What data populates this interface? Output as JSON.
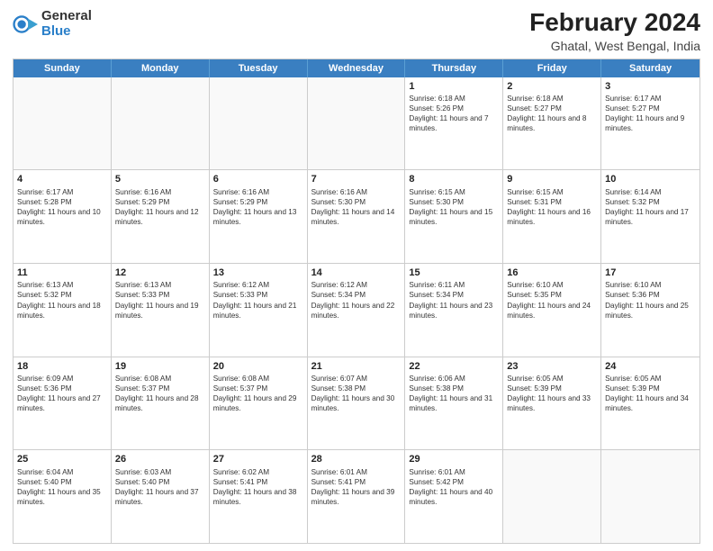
{
  "logo": {
    "general": "General",
    "blue": "Blue"
  },
  "title": "February 2024",
  "subtitle": "Ghatal, West Bengal, India",
  "headers": [
    "Sunday",
    "Monday",
    "Tuesday",
    "Wednesday",
    "Thursday",
    "Friday",
    "Saturday"
  ],
  "weeks": [
    [
      {
        "day": "",
        "info": "",
        "empty": true
      },
      {
        "day": "",
        "info": "",
        "empty": true
      },
      {
        "day": "",
        "info": "",
        "empty": true
      },
      {
        "day": "",
        "info": "",
        "empty": true
      },
      {
        "day": "1",
        "info": "Sunrise: 6:18 AM\nSunset: 5:26 PM\nDaylight: 11 hours and 7 minutes."
      },
      {
        "day": "2",
        "info": "Sunrise: 6:18 AM\nSunset: 5:27 PM\nDaylight: 11 hours and 8 minutes."
      },
      {
        "day": "3",
        "info": "Sunrise: 6:17 AM\nSunset: 5:27 PM\nDaylight: 11 hours and 9 minutes."
      }
    ],
    [
      {
        "day": "4",
        "info": "Sunrise: 6:17 AM\nSunset: 5:28 PM\nDaylight: 11 hours and 10 minutes."
      },
      {
        "day": "5",
        "info": "Sunrise: 6:16 AM\nSunset: 5:29 PM\nDaylight: 11 hours and 12 minutes."
      },
      {
        "day": "6",
        "info": "Sunrise: 6:16 AM\nSunset: 5:29 PM\nDaylight: 11 hours and 13 minutes."
      },
      {
        "day": "7",
        "info": "Sunrise: 6:16 AM\nSunset: 5:30 PM\nDaylight: 11 hours and 14 minutes."
      },
      {
        "day": "8",
        "info": "Sunrise: 6:15 AM\nSunset: 5:30 PM\nDaylight: 11 hours and 15 minutes."
      },
      {
        "day": "9",
        "info": "Sunrise: 6:15 AM\nSunset: 5:31 PM\nDaylight: 11 hours and 16 minutes."
      },
      {
        "day": "10",
        "info": "Sunrise: 6:14 AM\nSunset: 5:32 PM\nDaylight: 11 hours and 17 minutes."
      }
    ],
    [
      {
        "day": "11",
        "info": "Sunrise: 6:13 AM\nSunset: 5:32 PM\nDaylight: 11 hours and 18 minutes."
      },
      {
        "day": "12",
        "info": "Sunrise: 6:13 AM\nSunset: 5:33 PM\nDaylight: 11 hours and 19 minutes."
      },
      {
        "day": "13",
        "info": "Sunrise: 6:12 AM\nSunset: 5:33 PM\nDaylight: 11 hours and 21 minutes."
      },
      {
        "day": "14",
        "info": "Sunrise: 6:12 AM\nSunset: 5:34 PM\nDaylight: 11 hours and 22 minutes."
      },
      {
        "day": "15",
        "info": "Sunrise: 6:11 AM\nSunset: 5:34 PM\nDaylight: 11 hours and 23 minutes."
      },
      {
        "day": "16",
        "info": "Sunrise: 6:10 AM\nSunset: 5:35 PM\nDaylight: 11 hours and 24 minutes."
      },
      {
        "day": "17",
        "info": "Sunrise: 6:10 AM\nSunset: 5:36 PM\nDaylight: 11 hours and 25 minutes."
      }
    ],
    [
      {
        "day": "18",
        "info": "Sunrise: 6:09 AM\nSunset: 5:36 PM\nDaylight: 11 hours and 27 minutes."
      },
      {
        "day": "19",
        "info": "Sunrise: 6:08 AM\nSunset: 5:37 PM\nDaylight: 11 hours and 28 minutes."
      },
      {
        "day": "20",
        "info": "Sunrise: 6:08 AM\nSunset: 5:37 PM\nDaylight: 11 hours and 29 minutes."
      },
      {
        "day": "21",
        "info": "Sunrise: 6:07 AM\nSunset: 5:38 PM\nDaylight: 11 hours and 30 minutes."
      },
      {
        "day": "22",
        "info": "Sunrise: 6:06 AM\nSunset: 5:38 PM\nDaylight: 11 hours and 31 minutes."
      },
      {
        "day": "23",
        "info": "Sunrise: 6:05 AM\nSunset: 5:39 PM\nDaylight: 11 hours and 33 minutes."
      },
      {
        "day": "24",
        "info": "Sunrise: 6:05 AM\nSunset: 5:39 PM\nDaylight: 11 hours and 34 minutes."
      }
    ],
    [
      {
        "day": "25",
        "info": "Sunrise: 6:04 AM\nSunset: 5:40 PM\nDaylight: 11 hours and 35 minutes."
      },
      {
        "day": "26",
        "info": "Sunrise: 6:03 AM\nSunset: 5:40 PM\nDaylight: 11 hours and 37 minutes."
      },
      {
        "day": "27",
        "info": "Sunrise: 6:02 AM\nSunset: 5:41 PM\nDaylight: 11 hours and 38 minutes."
      },
      {
        "day": "28",
        "info": "Sunrise: 6:01 AM\nSunset: 5:41 PM\nDaylight: 11 hours and 39 minutes."
      },
      {
        "day": "29",
        "info": "Sunrise: 6:01 AM\nSunset: 5:42 PM\nDaylight: 11 hours and 40 minutes."
      },
      {
        "day": "",
        "info": "",
        "empty": true
      },
      {
        "day": "",
        "info": "",
        "empty": true
      }
    ]
  ]
}
